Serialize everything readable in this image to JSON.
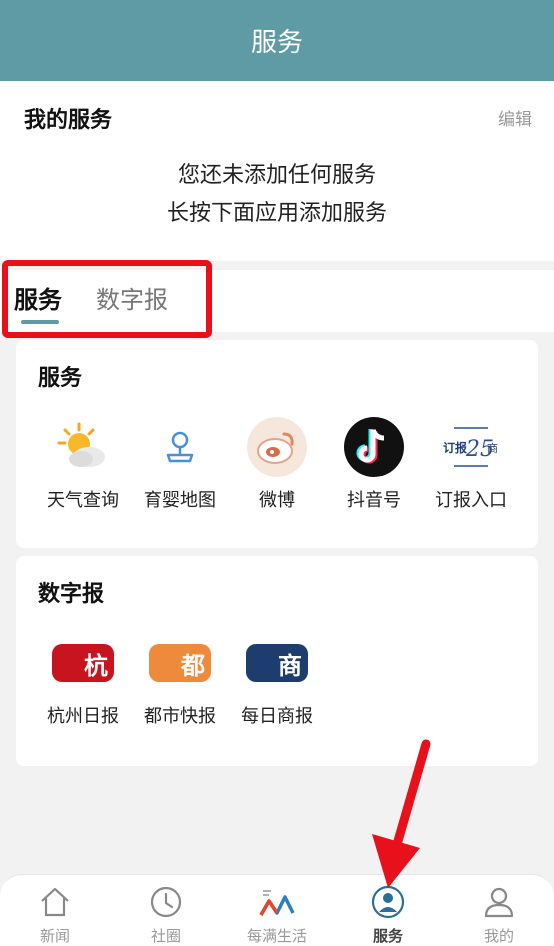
{
  "header": {
    "title": "服务"
  },
  "my_services": {
    "title": "我的服务",
    "edit_label": "编辑",
    "empty_line1": "您还未添加任何服务",
    "empty_line2": "长按下面应用添加服务"
  },
  "tabs": [
    {
      "label": "服务",
      "active": true
    },
    {
      "label": "数字报",
      "active": false
    }
  ],
  "services_section": {
    "title": "服务",
    "items": [
      {
        "label": "天气查询",
        "icon": "weather-icon"
      },
      {
        "label": "育婴地图",
        "icon": "map-pin-icon"
      },
      {
        "label": "微博",
        "icon": "weibo-icon"
      },
      {
        "label": "抖音号",
        "icon": "douyin-icon"
      },
      {
        "label": "订报入口",
        "icon": "newspaper-subscribe-icon"
      }
    ]
  },
  "papers_section": {
    "title": "数字报",
    "items": [
      {
        "label": "杭州日报",
        "icon": "hangzhou-daily-icon",
        "color": "#c8141e",
        "glyph": "杭"
      },
      {
        "label": "都市快报",
        "icon": "metro-express-icon",
        "color": "#ee8a3c",
        "glyph": "都"
      },
      {
        "label": "每日商报",
        "icon": "daily-business-icon",
        "color": "#1c3d6e",
        "glyph": "商"
      }
    ]
  },
  "tabbar": [
    {
      "label": "新闻",
      "icon": "home-icon",
      "active": false
    },
    {
      "label": "社圈",
      "icon": "clock-icon",
      "active": false
    },
    {
      "label": "每满生活",
      "icon": "life-logo-icon",
      "active": false
    },
    {
      "label": "服务",
      "icon": "service-person-icon",
      "active": true
    },
    {
      "label": "我的",
      "icon": "user-icon",
      "active": false
    }
  ],
  "colors": {
    "accent": "#5f9ba4",
    "highlight": "#e8101a"
  }
}
